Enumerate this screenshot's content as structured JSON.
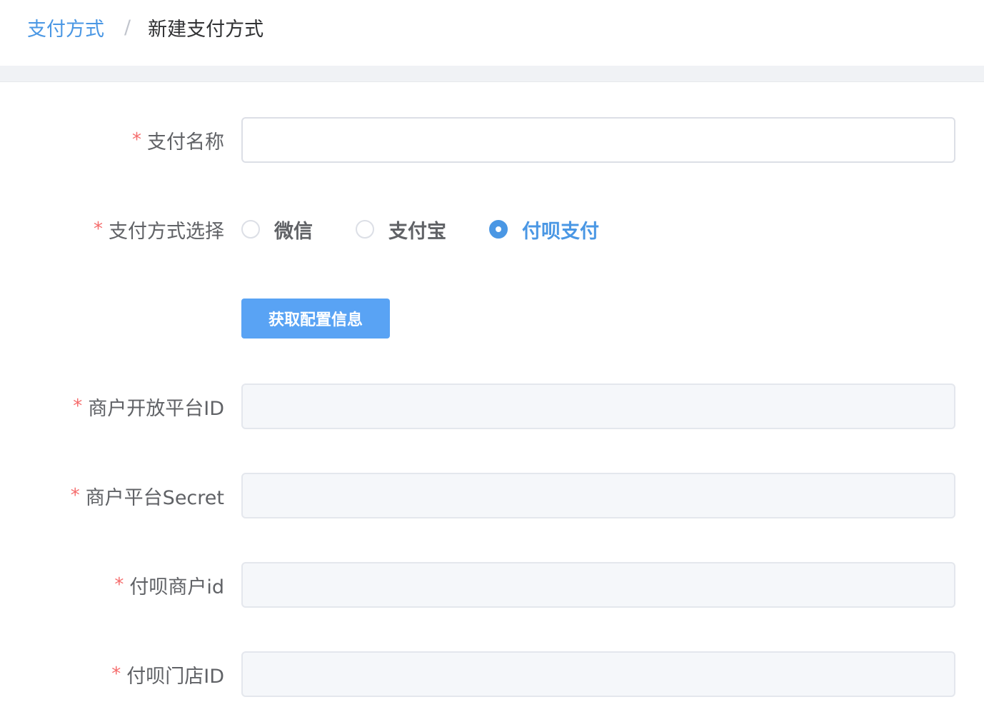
{
  "breadcrumb": {
    "parent": "支付方式",
    "separator": "/",
    "current": "新建支付方式"
  },
  "form": {
    "required_mark": "*",
    "payment_name": {
      "label": "支付名称",
      "value": ""
    },
    "payment_method": {
      "label": "支付方式选择",
      "options": [
        {
          "label": "微信",
          "checked": false
        },
        {
          "label": "支付宝",
          "checked": false
        },
        {
          "label": "付呗支付",
          "checked": true
        }
      ]
    },
    "fetch_button_label": "获取配置信息",
    "merchant_open_platform_id": {
      "label": "商户开放平台ID",
      "value": "",
      "disabled": true
    },
    "merchant_platform_secret": {
      "label": "商户平台Secret",
      "value": "",
      "disabled": true
    },
    "fubei_merchant_id": {
      "label": "付呗商户id",
      "value": "",
      "disabled": true
    },
    "fubei_store_id": {
      "label": "付呗门店ID",
      "value": "",
      "disabled": true
    }
  },
  "colors": {
    "accent": "#4a97e4",
    "button": "#59a3f4",
    "required": "#f56c6c",
    "disabled_bg": "#f5f7fa"
  }
}
